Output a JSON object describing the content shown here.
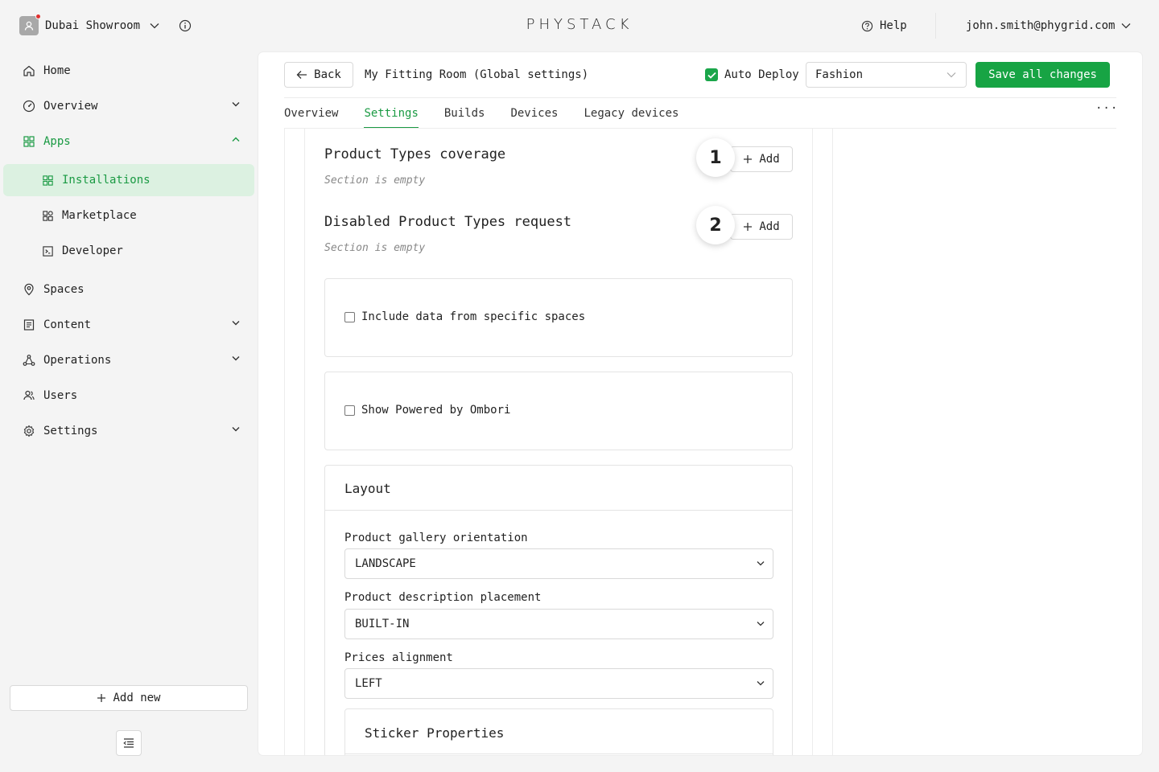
{
  "topbar": {
    "org_name": "Dubai Showroom",
    "logo": "PHYSTACK",
    "help_label": "Help",
    "user_email": "john.smith@phygrid.com"
  },
  "sidebar": {
    "items": [
      {
        "label": "Home",
        "icon": "home-icon"
      },
      {
        "label": "Overview",
        "icon": "dashboard-icon"
      },
      {
        "label": "Apps",
        "icon": "apps-icon"
      },
      {
        "label": "Installations",
        "icon": "grid-icon"
      },
      {
        "label": "Marketplace",
        "icon": "marketplace-icon"
      },
      {
        "label": "Developer",
        "icon": "terminal-icon"
      },
      {
        "label": "Spaces",
        "icon": "location-pin-icon"
      },
      {
        "label": "Content",
        "icon": "document-icon"
      },
      {
        "label": "Operations",
        "icon": "network-icon"
      },
      {
        "label": "Users",
        "icon": "users-icon"
      },
      {
        "label": "Settings",
        "icon": "gear-icon"
      }
    ],
    "add_new_label": "Add new"
  },
  "header": {
    "back_label": "Back",
    "title": "My Fitting Room (Global settings)",
    "auto_deploy_label": "Auto Deploy",
    "auto_deploy_checked": true,
    "environment_value": "Fashion",
    "save_label": "Save all changes"
  },
  "tabs": [
    {
      "label": "Overview",
      "active": false
    },
    {
      "label": "Settings",
      "active": true
    },
    {
      "label": "Builds",
      "active": false
    },
    {
      "label": "Devices",
      "active": false
    },
    {
      "label": "Legacy devices",
      "active": false
    }
  ],
  "tabs_more": "···",
  "sections": [
    {
      "title": "Product Types coverage",
      "empty_text": "Section is empty",
      "add_label": "Add",
      "step": "1"
    },
    {
      "title": "Disabled Product Types request",
      "empty_text": "Section is empty",
      "add_label": "Add",
      "step": "2"
    }
  ],
  "checkboxes": [
    {
      "label": "Include data from specific spaces",
      "checked": false
    },
    {
      "label": "Show Powered by Ombori",
      "checked": false
    }
  ],
  "layout": {
    "title": "Layout",
    "fields": [
      {
        "label": "Product gallery orientation",
        "value": "LANDSCAPE"
      },
      {
        "label": "Product description placement",
        "value": "BUILT-IN"
      },
      {
        "label": "Prices alignment",
        "value": "LEFT"
      }
    ],
    "sticker_title": "Sticker Properties"
  },
  "colors": {
    "accent": "#1a9a43",
    "primary_button": "#17a444",
    "active_nav_bg": "#dcf1e1",
    "notification_dot": "#e0312f"
  }
}
